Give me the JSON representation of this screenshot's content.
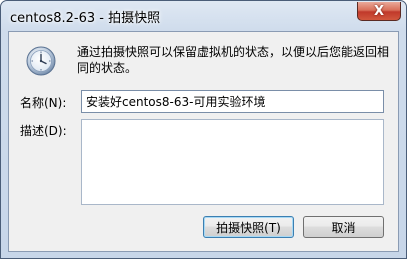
{
  "window": {
    "title": "centos8.2-63 - 拍摄快照",
    "close_symbol": "X"
  },
  "dialog": {
    "message": "通过拍摄快照可以保留虚拟机的状态，以便以后您能返回相同的状态。",
    "name_label": "名称(N):",
    "name_value": "安装好centos8-63-可用实验环境",
    "description_label": "描述(D):",
    "description_value": "",
    "take_snapshot_button": "拍摄快照(T)",
    "cancel_button": "取消"
  },
  "colors": {
    "titlebar": "#cfdcec",
    "client_bg": "#f0f0f0",
    "close_button": "#c0392b",
    "default_button_border": "#3c7fb1"
  },
  "icons": {
    "dialog_icon": "clock-icon",
    "close": "close-icon"
  }
}
